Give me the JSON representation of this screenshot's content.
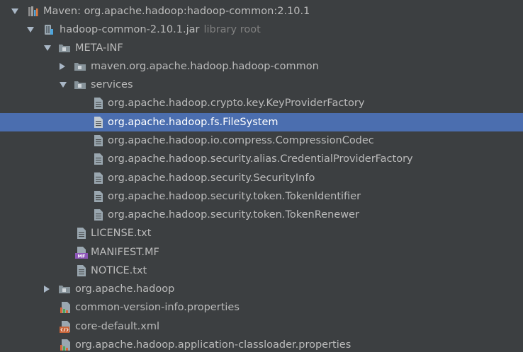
{
  "project_tree": {
    "root": {
      "label": "Maven: org.apache.hadoop:hadoop-common:2.10.1",
      "icon": "maven-library-icon"
    },
    "jar": {
      "label": "hadoop-common-2.10.1.jar",
      "hint": "library root",
      "icon": "jar-icon"
    },
    "meta_inf": {
      "label": "META-INF",
      "icon": "package-icon"
    },
    "maven_folder": {
      "label": "maven.org.apache.hadoop.hadoop-common",
      "icon": "package-icon"
    },
    "services_folder": {
      "label": "services",
      "icon": "package-icon"
    },
    "services": [
      {
        "label": "org.apache.hadoop.crypto.key.KeyProviderFactory",
        "icon": "text-file-icon"
      },
      {
        "label": "org.apache.hadoop.fs.FileSystem",
        "icon": "text-file-icon",
        "selected": true
      },
      {
        "label": "org.apache.hadoop.io.compress.CompressionCodec",
        "icon": "text-file-icon"
      },
      {
        "label": "org.apache.hadoop.security.alias.CredentialProviderFactory",
        "icon": "text-file-icon"
      },
      {
        "label": "org.apache.hadoop.security.SecurityInfo",
        "icon": "text-file-icon"
      },
      {
        "label": "org.apache.hadoop.security.token.TokenIdentifier",
        "icon": "text-file-icon"
      },
      {
        "label": "org.apache.hadoop.security.token.TokenRenewer",
        "icon": "text-file-icon"
      }
    ],
    "meta_files": [
      {
        "label": "LICENSE.txt",
        "icon": "text-file-icon"
      },
      {
        "label": "MANIFEST.MF",
        "icon": "manifest-file-icon",
        "badge": "MF"
      },
      {
        "label": "NOTICE.txt",
        "icon": "text-file-icon"
      }
    ],
    "hadoop_package": {
      "label": "org.apache.hadoop",
      "icon": "package-icon"
    },
    "root_files": [
      {
        "label": "common-version-info.properties",
        "icon": "properties-file-icon"
      },
      {
        "label": "core-default.xml",
        "icon": "xml-file-icon"
      },
      {
        "label": "org.apache.hadoop.application-classloader.properties",
        "icon": "properties-file-icon"
      }
    ]
  },
  "colors": {
    "background": "#3c3f41",
    "selection": "#4b6eaf",
    "text": "#bbbbbb",
    "hint": "#808080"
  }
}
